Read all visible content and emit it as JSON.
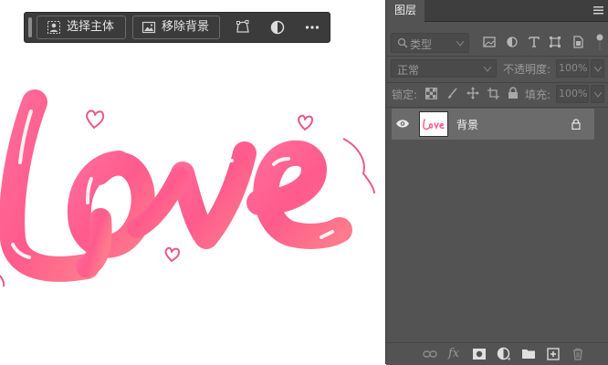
{
  "taskbar": {
    "select_subject_label": "选择主体",
    "remove_background_label": "移除背景"
  },
  "layers_panel": {
    "tab_title": "图层",
    "filter_kind_placeholder": "类型",
    "blend_mode": "正常",
    "opacity_label": "不透明度:",
    "opacity_value": "100%",
    "lock_label": "锁定:",
    "fill_label": "填充:",
    "fill_value": "100%",
    "layers": [
      {
        "name": "背景",
        "visible": true,
        "locked": true,
        "thumbnail_text": "Love"
      }
    ]
  },
  "colors": {
    "panel_bg": "#535353",
    "selected_layer": "#6b6b6b",
    "love_pink": "#ff5f8f"
  }
}
